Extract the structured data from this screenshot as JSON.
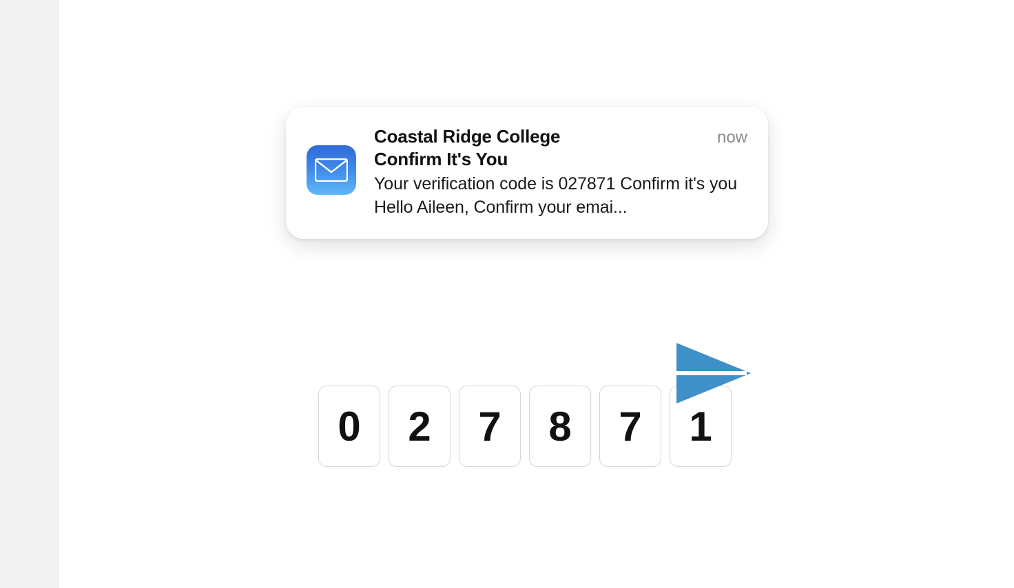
{
  "notification": {
    "sender": "Coastal Ridge College",
    "subject": "Confirm It's You",
    "preview": "Your verification code is 027871 Confirm it's you Hello Aileen, Confirm your emai...",
    "timestamp": "now"
  },
  "otp": {
    "digits": [
      "0",
      "2",
      "7",
      "8",
      "7",
      "1"
    ]
  },
  "colors": {
    "mail_icon_gradient_top": "#2e6bd6",
    "mail_icon_gradient_bottom": "#5fb8f8",
    "send_plane": "#3f8fc8"
  }
}
